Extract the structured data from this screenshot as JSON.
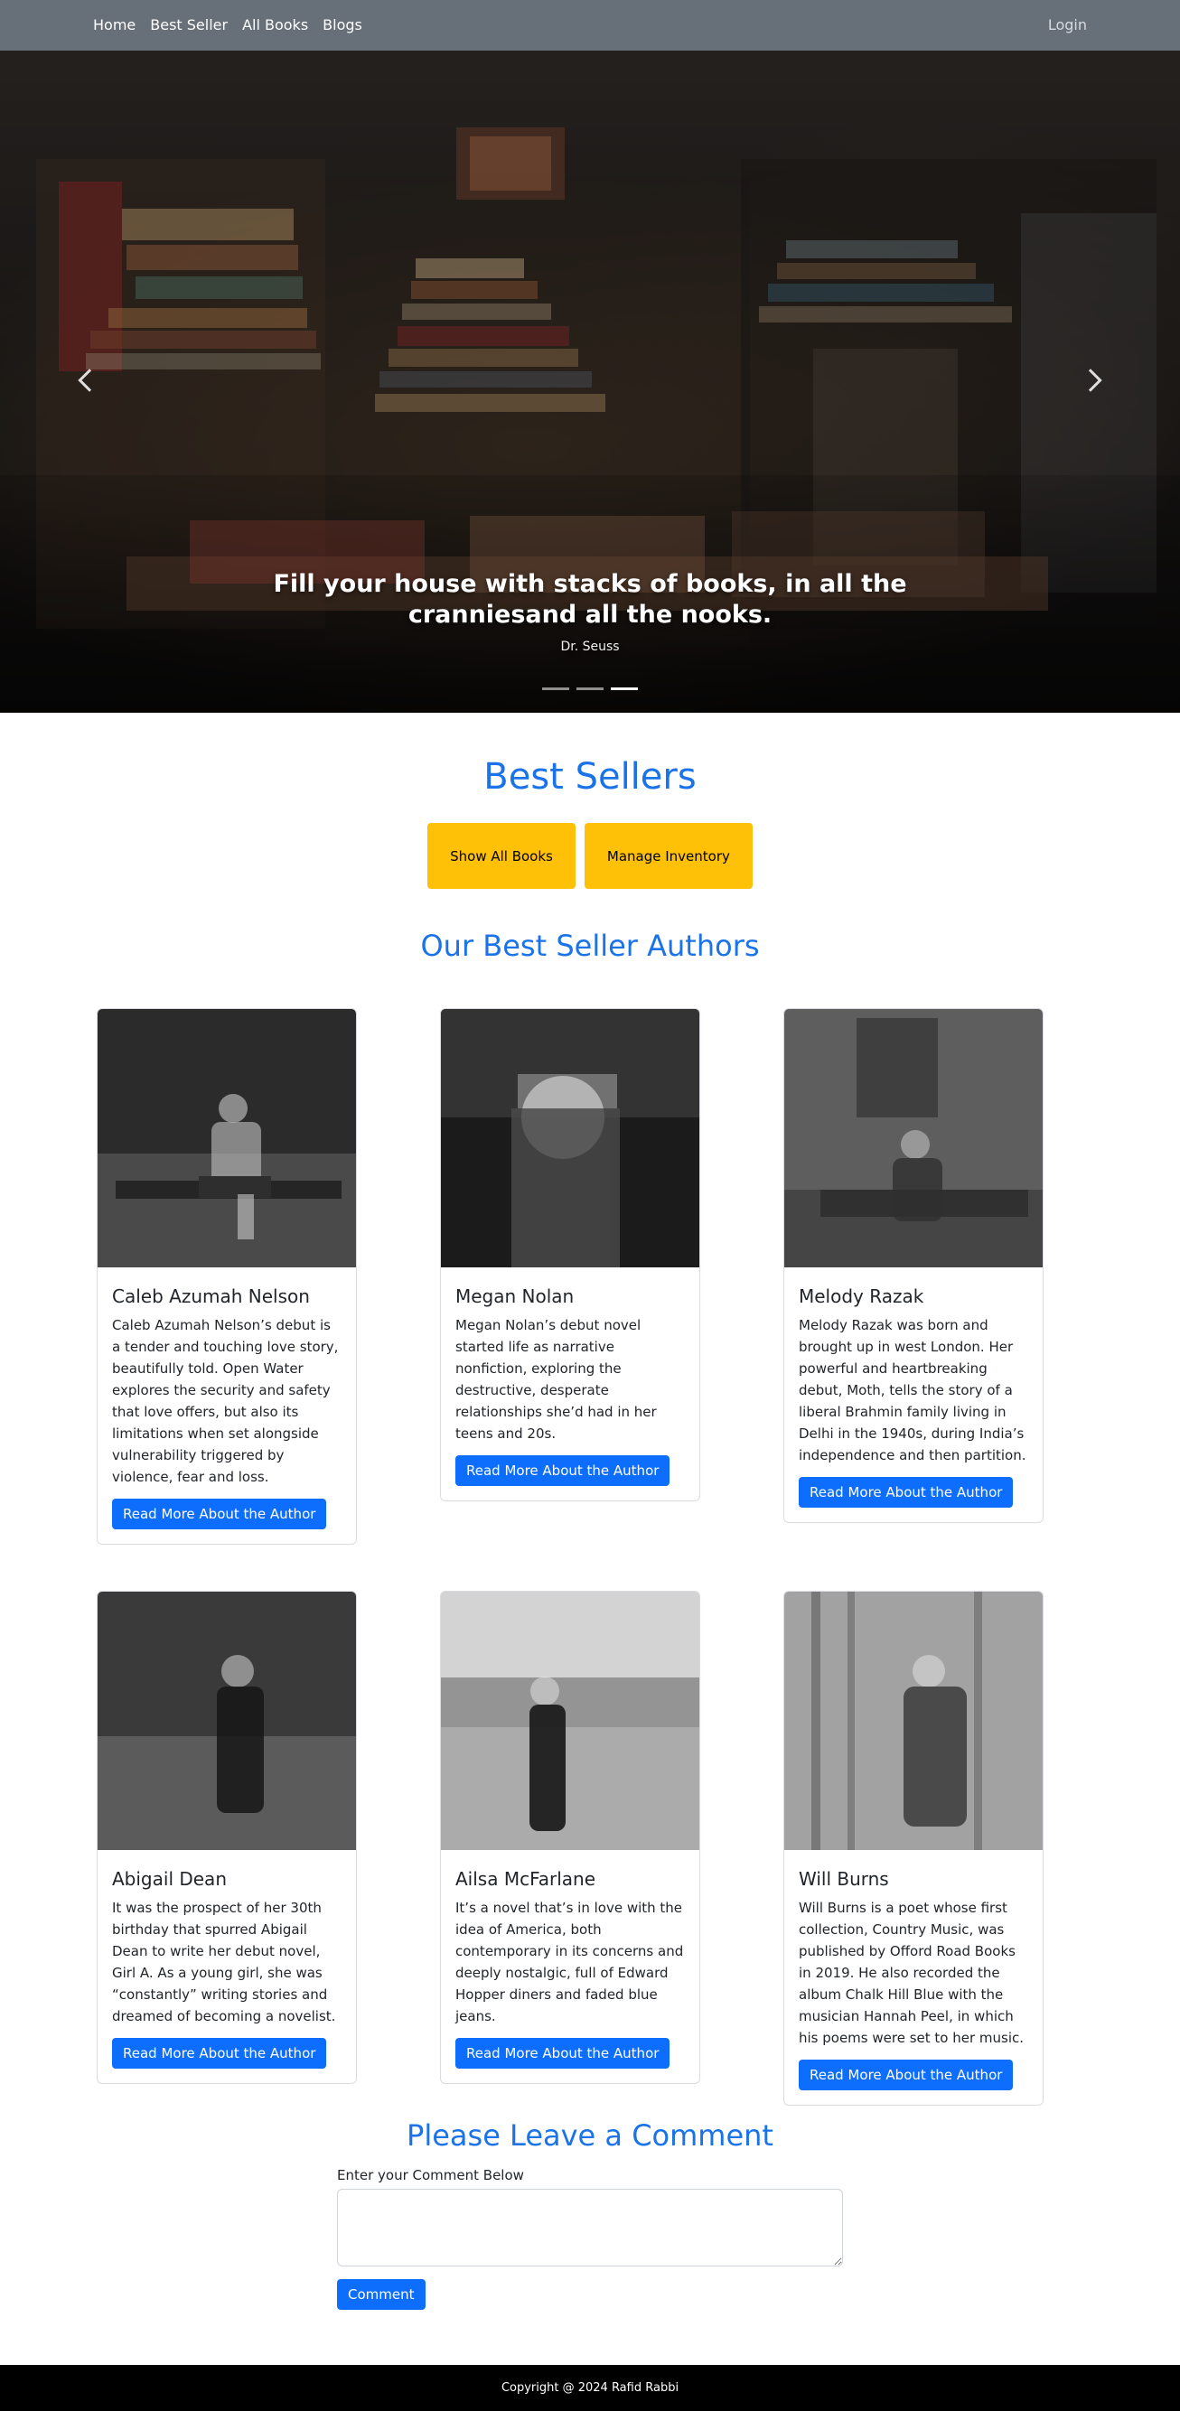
{
  "nav": {
    "links": [
      {
        "label": "Home"
      },
      {
        "label": "Best Seller"
      },
      {
        "label": "All Books"
      },
      {
        "label": "Blogs"
      }
    ],
    "login_label": "Login"
  },
  "hero": {
    "quote": "Fill your house with stacks of books, in all the cranniesand all the nooks.",
    "author": "Dr. Seuss",
    "slides": 3,
    "active_slide": 3
  },
  "best_sellers": {
    "title": "Best Sellers",
    "show_all_label": "Show All Books",
    "manage_inventory_label": "Manage Inventory"
  },
  "authors_section": {
    "title": "Our Best Seller Authors",
    "read_more_label": "Read More About the Author",
    "authors": [
      {
        "name": "Caleb Azumah Nelson",
        "description": "Caleb Azumah Nelson’s debut is a tender and touching love story, beautifully told. Open Water explores the security and safety that love offers, but also its limitations when set alongside vulnerability triggered by violence, fear and loss."
      },
      {
        "name": "Megan Nolan",
        "description": "Megan Nolan’s debut novel started life as narrative nonfiction, exploring the destructive, desperate relationships she’d had in her teens and 20s."
      },
      {
        "name": "Melody Razak",
        "description": "Melody Razak was born and brought up in west London. Her powerful and heartbreaking debut, Moth, tells the story of a liberal Brahmin family living in Delhi in the 1940s, during India’s independence and then partition."
      },
      {
        "name": "Abigail Dean",
        "description": "It was the prospect of her 30th birthday that spurred Abigail Dean to write her debut novel, Girl A. As a young girl, she was “constantly” writing stories and dreamed of becoming a novelist."
      },
      {
        "name": "Ailsa McFarlane",
        "description": "It’s a novel that’s in love with the idea of America, both contemporary in its concerns and deeply nostalgic, full of Edward Hopper diners and faded blue jeans."
      },
      {
        "name": "Will Burns",
        "description": "Will Burns is a poet whose first collection, Country Music, was published by Offord Road Books in 2019. He also recorded the album Chalk Hill Blue with the musician Hannah Peel, in which his poems were set to her music."
      }
    ]
  },
  "comment": {
    "title": "Please Leave a Comment",
    "label": "Enter your Comment Below",
    "placeholder": "",
    "button_label": "Comment"
  },
  "footer": {
    "text": "Copyright @ 2024 Rafid Rabbi"
  },
  "colors": {
    "navbar": "#676f78",
    "accent_blue": "#1a73e8",
    "primary_button": "#0d6efd",
    "warning_button": "#ffc107",
    "footer": "#000000"
  },
  "icons": {
    "carousel_prev": "chevron-left-icon",
    "carousel_next": "chevron-right-icon"
  }
}
